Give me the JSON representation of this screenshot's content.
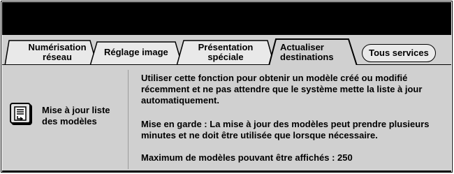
{
  "tabs": [
    {
      "label": "Numérisation réseau"
    },
    {
      "label": "Réglage image"
    },
    {
      "label": "Présentation spéciale"
    },
    {
      "label": "Actualiser destinations",
      "active": true
    }
  ],
  "all_services_label": "Tous services",
  "feature": {
    "icon": "template-list-icon",
    "label": "Mise à jour liste des modèles"
  },
  "content": {
    "description": "Utiliser cette fonction pour obtenir un modèle créé ou modifié récemment et ne pas attendre que le système mette la liste à jour automatiquement.",
    "warning": "Mise en garde : La mise à jour des modèles peut prendre plusieurs minutes et ne doit être utilisée que lorsque nécessaire.",
    "max_label": "Maximum de modèles pouvant être affichés :",
    "max_value": "250"
  }
}
